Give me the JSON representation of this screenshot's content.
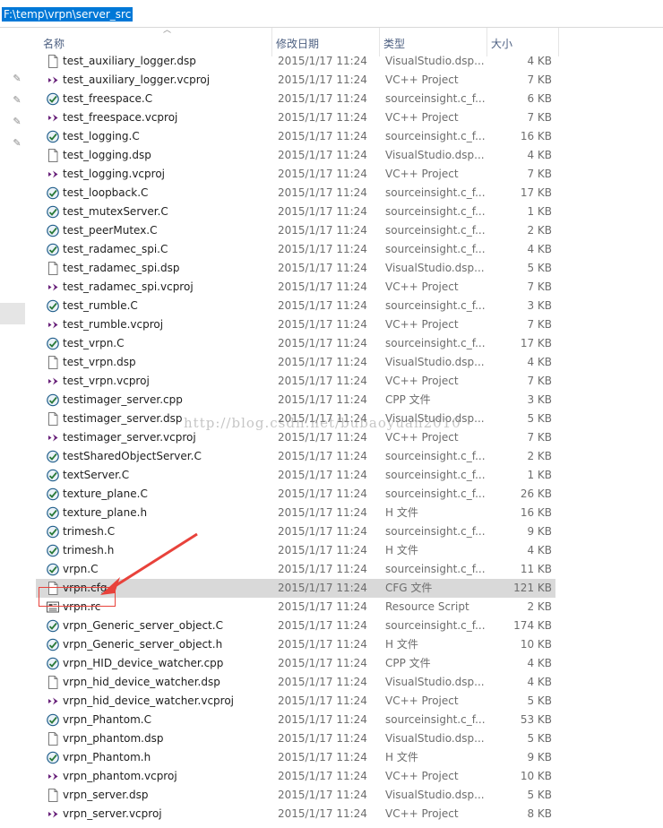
{
  "address_bar": {
    "path": "F:\\temp\\vrpn\\server_src"
  },
  "columns": {
    "name": "名称",
    "date": "修改日期",
    "type": "类型",
    "size": "大小"
  },
  "watermark": "http://blog.csdn.net/bubaoyuan2010",
  "files": [
    {
      "name": "test_auxiliary_logger.dsp",
      "date": "2015/1/17 11:24",
      "type": "VisualStudio.dsp...",
      "size": "4 KB",
      "icon": "dsp-file-icon"
    },
    {
      "name": "test_auxiliary_logger.vcproj",
      "date": "2015/1/17 11:24",
      "type": "VC++ Project",
      "size": "7 KB",
      "icon": "vcproj-file-icon"
    },
    {
      "name": "test_freespace.C",
      "date": "2015/1/17 11:24",
      "type": "sourceinsight.c_f...",
      "size": "6 KB",
      "icon": "c-source-file-icon"
    },
    {
      "name": "test_freespace.vcproj",
      "date": "2015/1/17 11:24",
      "type": "VC++ Project",
      "size": "7 KB",
      "icon": "vcproj-file-icon"
    },
    {
      "name": "test_logging.C",
      "date": "2015/1/17 11:24",
      "type": "sourceinsight.c_f...",
      "size": "16 KB",
      "icon": "c-source-file-icon"
    },
    {
      "name": "test_logging.dsp",
      "date": "2015/1/17 11:24",
      "type": "VisualStudio.dsp...",
      "size": "4 KB",
      "icon": "dsp-file-icon"
    },
    {
      "name": "test_logging.vcproj",
      "date": "2015/1/17 11:24",
      "type": "VC++ Project",
      "size": "7 KB",
      "icon": "vcproj-file-icon"
    },
    {
      "name": "test_loopback.C",
      "date": "2015/1/17 11:24",
      "type": "sourceinsight.c_f...",
      "size": "17 KB",
      "icon": "c-source-file-icon"
    },
    {
      "name": "test_mutexServer.C",
      "date": "2015/1/17 11:24",
      "type": "sourceinsight.c_f...",
      "size": "1 KB",
      "icon": "c-source-file-icon"
    },
    {
      "name": "test_peerMutex.C",
      "date": "2015/1/17 11:24",
      "type": "sourceinsight.c_f...",
      "size": "2 KB",
      "icon": "c-source-file-icon"
    },
    {
      "name": "test_radamec_spi.C",
      "date": "2015/1/17 11:24",
      "type": "sourceinsight.c_f...",
      "size": "4 KB",
      "icon": "c-source-file-icon"
    },
    {
      "name": "test_radamec_spi.dsp",
      "date": "2015/1/17 11:24",
      "type": "VisualStudio.dsp...",
      "size": "5 KB",
      "icon": "dsp-file-icon"
    },
    {
      "name": "test_radamec_spi.vcproj",
      "date": "2015/1/17 11:24",
      "type": "VC++ Project",
      "size": "7 KB",
      "icon": "vcproj-file-icon"
    },
    {
      "name": "test_rumble.C",
      "date": "2015/1/17 11:24",
      "type": "sourceinsight.c_f...",
      "size": "3 KB",
      "icon": "c-source-file-icon"
    },
    {
      "name": "test_rumble.vcproj",
      "date": "2015/1/17 11:24",
      "type": "VC++ Project",
      "size": "7 KB",
      "icon": "vcproj-file-icon"
    },
    {
      "name": "test_vrpn.C",
      "date": "2015/1/17 11:24",
      "type": "sourceinsight.c_f...",
      "size": "17 KB",
      "icon": "c-source-file-icon"
    },
    {
      "name": "test_vrpn.dsp",
      "date": "2015/1/17 11:24",
      "type": "VisualStudio.dsp...",
      "size": "4 KB",
      "icon": "dsp-file-icon"
    },
    {
      "name": "test_vrpn.vcproj",
      "date": "2015/1/17 11:24",
      "type": "VC++ Project",
      "size": "7 KB",
      "icon": "vcproj-file-icon"
    },
    {
      "name": "testimager_server.cpp",
      "date": "2015/1/17 11:24",
      "type": "CPP 文件",
      "size": "3 KB",
      "icon": "cpp-source-file-icon"
    },
    {
      "name": "testimager_server.dsp",
      "date": "2015/1/17 11:24",
      "type": "VisualStudio.dsp...",
      "size": "5 KB",
      "icon": "dsp-file-icon"
    },
    {
      "name": "testimager_server.vcproj",
      "date": "2015/1/17 11:24",
      "type": "VC++ Project",
      "size": "7 KB",
      "icon": "vcproj-file-icon"
    },
    {
      "name": "testSharedObjectServer.C",
      "date": "2015/1/17 11:24",
      "type": "sourceinsight.c_f...",
      "size": "2 KB",
      "icon": "c-source-file-icon"
    },
    {
      "name": "textServer.C",
      "date": "2015/1/17 11:24",
      "type": "sourceinsight.c_f...",
      "size": "1 KB",
      "icon": "c-source-file-icon"
    },
    {
      "name": "texture_plane.C",
      "date": "2015/1/17 11:24",
      "type": "sourceinsight.c_f...",
      "size": "26 KB",
      "icon": "c-source-file-icon"
    },
    {
      "name": "texture_plane.h",
      "date": "2015/1/17 11:24",
      "type": "H 文件",
      "size": "16 KB",
      "icon": "h-header-file-icon"
    },
    {
      "name": "trimesh.C",
      "date": "2015/1/17 11:24",
      "type": "sourceinsight.c_f...",
      "size": "9 KB",
      "icon": "c-source-file-icon"
    },
    {
      "name": "trimesh.h",
      "date": "2015/1/17 11:24",
      "type": "H 文件",
      "size": "4 KB",
      "icon": "h-header-file-icon"
    },
    {
      "name": "vrpn.C",
      "date": "2015/1/17 11:24",
      "type": "sourceinsight.c_f...",
      "size": "11 KB",
      "icon": "c-source-file-icon"
    },
    {
      "name": "vrpn.cfg",
      "date": "2015/1/17 11:24",
      "type": "CFG 文件",
      "size": "121 KB",
      "icon": "cfg-file-icon",
      "selected": true
    },
    {
      "name": "vrpn.rc",
      "date": "2015/1/17 11:24",
      "type": "Resource Script",
      "size": "2 KB",
      "icon": "rc-file-icon"
    },
    {
      "name": "vrpn_Generic_server_object.C",
      "date": "2015/1/17 11:24",
      "type": "sourceinsight.c_f...",
      "size": "174 KB",
      "icon": "c-source-file-icon"
    },
    {
      "name": "vrpn_Generic_server_object.h",
      "date": "2015/1/17 11:24",
      "type": "H 文件",
      "size": "10 KB",
      "icon": "h-header-file-icon"
    },
    {
      "name": "vrpn_HID_device_watcher.cpp",
      "date": "2015/1/17 11:24",
      "type": "CPP 文件",
      "size": "4 KB",
      "icon": "cpp-source-file-icon"
    },
    {
      "name": "vrpn_hid_device_watcher.dsp",
      "date": "2015/1/17 11:24",
      "type": "VisualStudio.dsp...",
      "size": "4 KB",
      "icon": "dsp-file-icon"
    },
    {
      "name": "vrpn_hid_device_watcher.vcproj",
      "date": "2015/1/17 11:24",
      "type": "VC++ Project",
      "size": "5 KB",
      "icon": "vcproj-file-icon"
    },
    {
      "name": "vrpn_Phantom.C",
      "date": "2015/1/17 11:24",
      "type": "sourceinsight.c_f...",
      "size": "53 KB",
      "icon": "c-source-file-icon"
    },
    {
      "name": "vrpn_phantom.dsp",
      "date": "2015/1/17 11:24",
      "type": "VisualStudio.dsp...",
      "size": "5 KB",
      "icon": "dsp-file-icon"
    },
    {
      "name": "vrpn_Phantom.h",
      "date": "2015/1/17 11:24",
      "type": "H 文件",
      "size": "9 KB",
      "icon": "h-header-file-icon"
    },
    {
      "name": "vrpn_phantom.vcproj",
      "date": "2015/1/17 11:24",
      "type": "VC++ Project",
      "size": "10 KB",
      "icon": "vcproj-file-icon"
    },
    {
      "name": "vrpn_server.dsp",
      "date": "2015/1/17 11:24",
      "type": "VisualStudio.dsp...",
      "size": "5 KB",
      "icon": "dsp-file-icon"
    },
    {
      "name": "vrpn_server.vcproj",
      "date": "2015/1/17 11:24",
      "type": "VC++ Project",
      "size": "8 KB",
      "icon": "vcproj-file-icon"
    }
  ],
  "colors": {
    "selection": "#d9d9d9",
    "address_highlight": "#0078d7",
    "annotation": "#e8423b"
  }
}
